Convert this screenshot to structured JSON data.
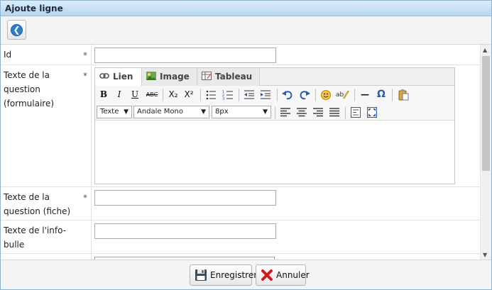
{
  "dialog": {
    "title": "Ajoute ligne"
  },
  "fields": [
    {
      "label": "Id",
      "required": "*"
    },
    {
      "label": "Texte de la question (formulaire)",
      "required": "*"
    },
    {
      "label": "Texte de la question (fiche)",
      "required": "*"
    },
    {
      "label": "Texte de l'info-bulle",
      "required": ""
    }
  ],
  "editor": {
    "tabs": [
      "Lien",
      "Image",
      "Tableau"
    ],
    "toolbar": {
      "bold": "B",
      "italic": "I",
      "underline": "U",
      "strike": "ABC",
      "subscript": "X₂",
      "superscript": "X²",
      "omega": "Ω",
      "hr": "—"
    },
    "format_select": "Texte",
    "font_select": "Andale Mono",
    "size_select": "8px"
  },
  "footer": {
    "save_label": "Enregistrer",
    "cancel_label": "Annuler"
  },
  "colors": {
    "title_bg": "#c9e0f2",
    "accent": "#2f7fc8",
    "cancel_red": "#d01c1c"
  }
}
